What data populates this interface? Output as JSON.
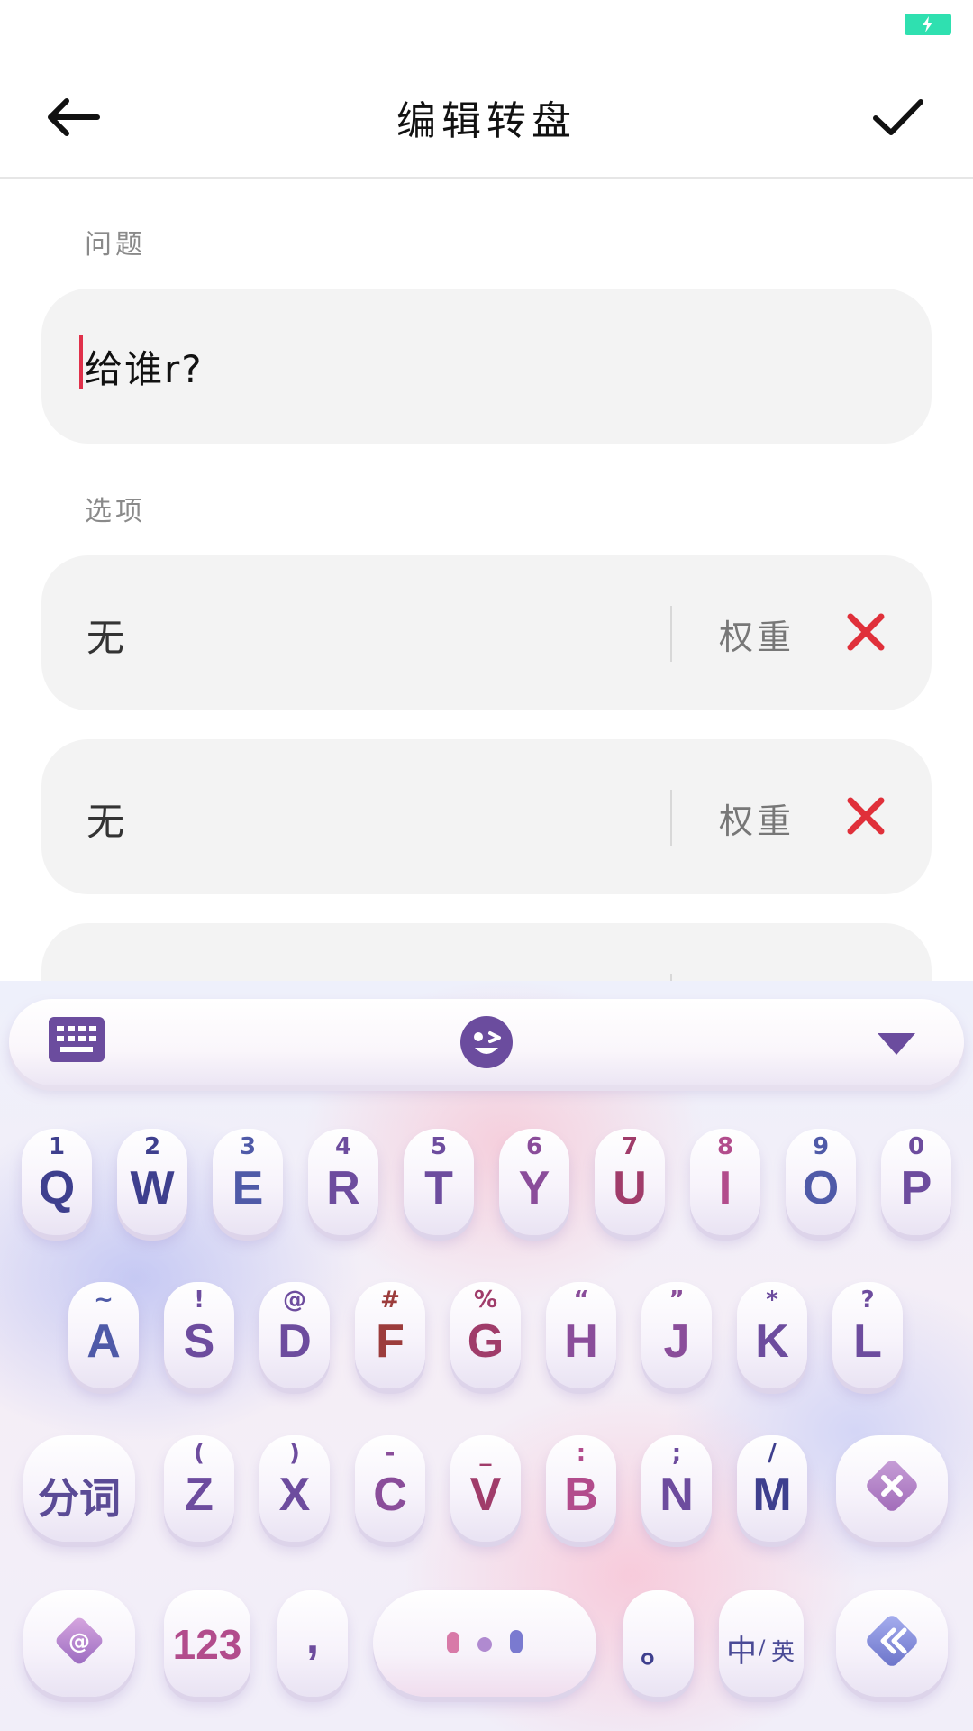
{
  "header": {
    "title": "编辑转盘"
  },
  "question": {
    "label": "问题",
    "value": "给谁r?"
  },
  "options": {
    "label": "选项",
    "items": [
      {
        "value": "无",
        "weight_label": "权重"
      },
      {
        "value": "无",
        "weight_label": "权重"
      }
    ]
  },
  "keyboard": {
    "row1": [
      {
        "main": "Q",
        "sub": "1"
      },
      {
        "main": "W",
        "sub": "2"
      },
      {
        "main": "E",
        "sub": "3"
      },
      {
        "main": "R",
        "sub": "4"
      },
      {
        "main": "T",
        "sub": "5"
      },
      {
        "main": "Y",
        "sub": "6"
      },
      {
        "main": "U",
        "sub": "7"
      },
      {
        "main": "I",
        "sub": "8"
      },
      {
        "main": "O",
        "sub": "9"
      },
      {
        "main": "P",
        "sub": "0"
      }
    ],
    "row2": [
      {
        "main": "A",
        "sub": "~"
      },
      {
        "main": "S",
        "sub": "!"
      },
      {
        "main": "D",
        "sub": "@"
      },
      {
        "main": "F",
        "sub": "#"
      },
      {
        "main": "G",
        "sub": "%"
      },
      {
        "main": "H",
        "sub": "“"
      },
      {
        "main": "J",
        "sub": "”"
      },
      {
        "main": "K",
        "sub": "*"
      },
      {
        "main": "L",
        "sub": "?"
      }
    ],
    "row3": [
      {
        "main": "Z",
        "sub": "("
      },
      {
        "main": "X",
        "sub": ")"
      },
      {
        "main": "C",
        "sub": "-"
      },
      {
        "main": "V",
        "sub": "_"
      },
      {
        "main": "B",
        "sub": ":"
      },
      {
        "main": "N",
        "sub": ";"
      },
      {
        "main": "M",
        "sub": "/"
      }
    ],
    "segment_label": "分词",
    "numbers_label": "123",
    "comma_label": ",",
    "period_label": "。",
    "lang_label_cn": "中",
    "lang_label_sep": "/",
    "lang_label_en": "英",
    "at_label": "@",
    "accent_colors": {
      "delete": "#e0303a",
      "caret": "#e0304a",
      "battery": "#2fe0b0",
      "keyboard_icon": "#6b4c9e"
    }
  }
}
